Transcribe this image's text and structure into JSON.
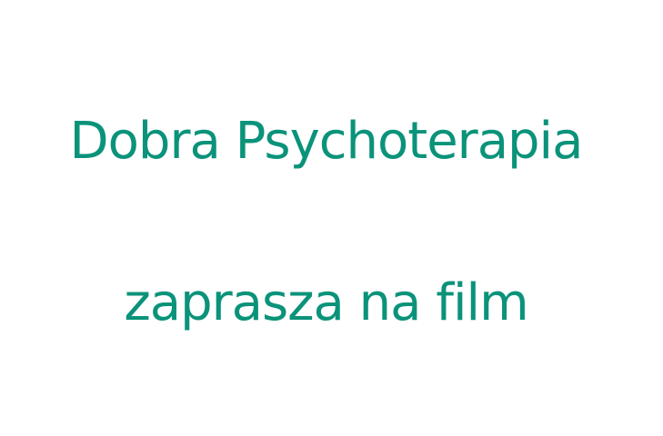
{
  "heading": {
    "line1": "Dobra Psychoterapia",
    "line2": "zaprasza na film"
  },
  "colors": {
    "text": "#0a937a",
    "background": "#ffffff"
  }
}
